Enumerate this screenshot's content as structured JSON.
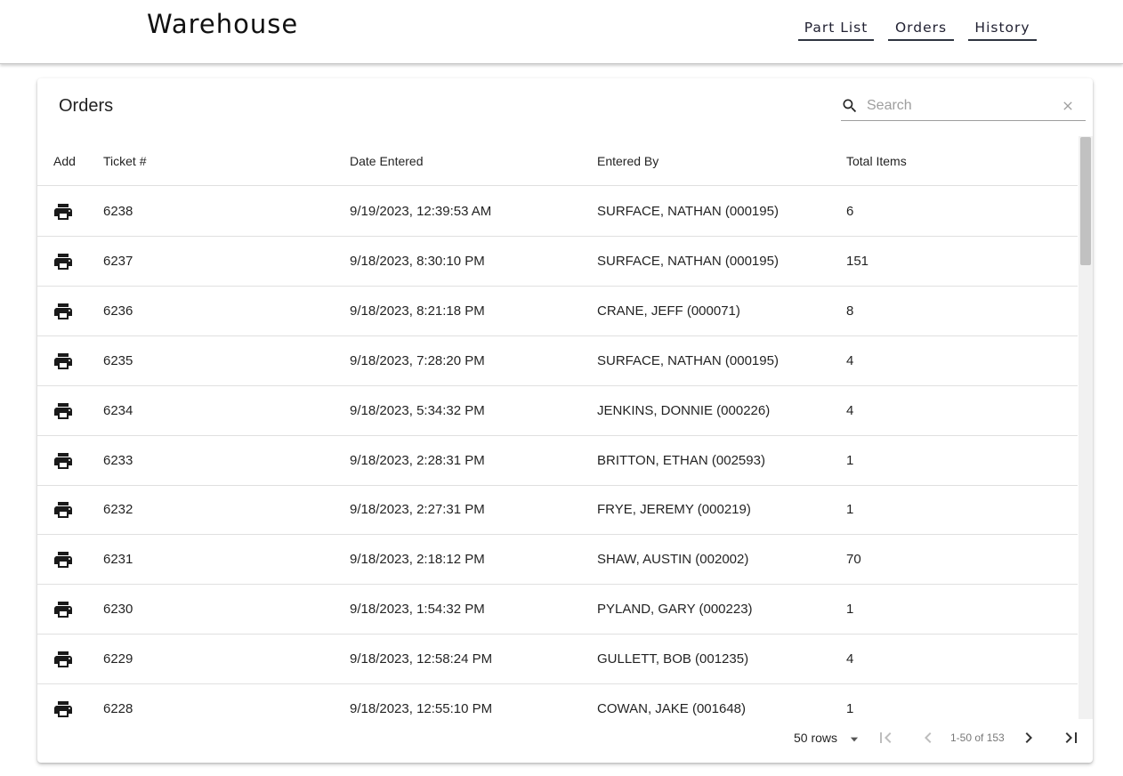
{
  "app": {
    "title": "Warehouse",
    "nav": [
      "Part List",
      "Orders",
      "History"
    ]
  },
  "orders": {
    "title": "Orders",
    "search": {
      "placeholder": "Search",
      "value": ""
    },
    "columns": [
      "Add",
      "Ticket #",
      "Date Entered",
      "Entered By",
      "Total Items"
    ],
    "rows": [
      {
        "ticket": "6238",
        "date": "9/19/2023, 12:39:53 AM",
        "by": "SURFACE, NATHAN (000195)",
        "total": "6"
      },
      {
        "ticket": "6237",
        "date": "9/18/2023, 8:30:10 PM",
        "by": "SURFACE, NATHAN (000195)",
        "total": "151"
      },
      {
        "ticket": "6236",
        "date": "9/18/2023, 8:21:18 PM",
        "by": "CRANE, JEFF (000071)",
        "total": "8"
      },
      {
        "ticket": "6235",
        "date": "9/18/2023, 7:28:20 PM",
        "by": "SURFACE, NATHAN (000195)",
        "total": "4"
      },
      {
        "ticket": "6234",
        "date": "9/18/2023, 5:34:32 PM",
        "by": "JENKINS, DONNIE (000226)",
        "total": "4"
      },
      {
        "ticket": "6233",
        "date": "9/18/2023, 2:28:31 PM",
        "by": "BRITTON, ETHAN (002593)",
        "total": "1"
      },
      {
        "ticket": "6232",
        "date": "9/18/2023, 2:27:31 PM",
        "by": "FRYE, JEREMY (000219)",
        "total": "1"
      },
      {
        "ticket": "6231",
        "date": "9/18/2023, 2:18:12 PM",
        "by": "SHAW, AUSTIN (002002)",
        "total": "70"
      },
      {
        "ticket": "6230",
        "date": "9/18/2023, 1:54:32 PM",
        "by": "PYLAND, GARY (000223)",
        "total": "1"
      },
      {
        "ticket": "6229",
        "date": "9/18/2023, 12:58:24 PM",
        "by": "GULLETT, BOB (001235)",
        "total": "4"
      },
      {
        "ticket": "6228",
        "date": "9/18/2023, 12:55:10 PM",
        "by": "COWAN, JAKE (001648)",
        "total": "1"
      }
    ],
    "pagination": {
      "rows_per_page": "50 rows",
      "range": "1-50 of 153"
    }
  },
  "icons": {
    "row_action": "print-icon",
    "search": "search-icon",
    "clear": "close-icon",
    "rows_select": "arrow-drop-down-icon",
    "first_page": "first-page-icon",
    "previous_page": "chevron-left-icon",
    "next_page": "chevron-right-icon",
    "last_page": "last-page-icon"
  },
  "colors": {
    "text": "#212121",
    "divider": "#e0e0e0",
    "nav_underline": "#2e3440",
    "scroll_thumb": "#c1c1c1"
  }
}
